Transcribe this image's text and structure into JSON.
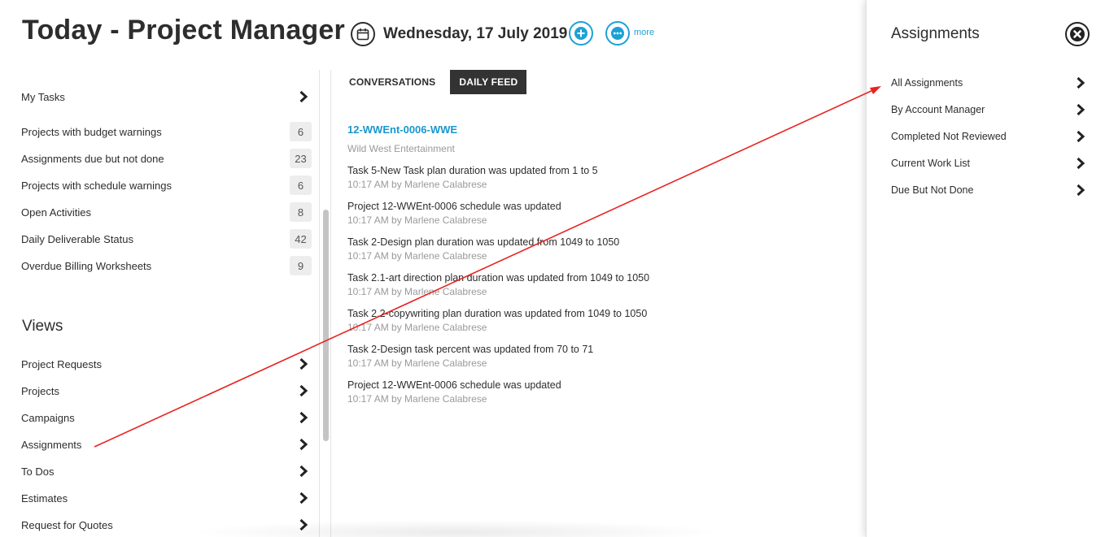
{
  "header": {
    "title": "Today - Project Manager",
    "date": "Wednesday, 17 July 2019",
    "more_label": "more"
  },
  "left": {
    "my_tasks_label": "My Tasks",
    "alerts": [
      {
        "label": "Projects with budget warnings",
        "count": "6"
      },
      {
        "label": "Assignments due but not done",
        "count": "23"
      },
      {
        "label": "Projects with schedule warnings",
        "count": "6"
      },
      {
        "label": "Open Activities",
        "count": "8"
      },
      {
        "label": "Daily Deliverable Status",
        "count": "42"
      },
      {
        "label": "Overdue Billing Worksheets",
        "count": "9"
      }
    ],
    "views_heading": "Views",
    "views": [
      {
        "label": "Project Requests"
      },
      {
        "label": "Projects"
      },
      {
        "label": "Campaigns"
      },
      {
        "label": "Assignments"
      },
      {
        "label": "To Dos"
      },
      {
        "label": "Estimates"
      },
      {
        "label": "Request for Quotes"
      }
    ]
  },
  "feed": {
    "tabs": [
      {
        "label": "CONVERSATIONS",
        "active": false
      },
      {
        "label": "DAILY FEED",
        "active": true
      }
    ],
    "project_link": "12-WWEnt-0006-WWE",
    "project_client": "Wild West Entertainment",
    "items": [
      {
        "text": "Task 5-New Task plan duration was updated from 1 to 5",
        "meta": "10:17 AM by Marlene Calabrese"
      },
      {
        "text": "Project 12-WWEnt-0006 schedule was updated",
        "meta": "10:17 AM by Marlene Calabrese"
      },
      {
        "text": "Task 2-Design plan duration was updated from 1049 to 1050",
        "meta": "10:17 AM by Marlene Calabrese"
      },
      {
        "text": "Task 2.1-art direction plan duration was updated from 1049 to 1050",
        "meta": "10:17 AM by Marlene Calabrese"
      },
      {
        "text": "Task 2.2-copywriting plan duration was updated from 1049 to 1050",
        "meta": "10:17 AM by Marlene Calabrese"
      },
      {
        "text": "Task 2-Design task percent was updated from 70 to 71",
        "meta": "10:17 AM by Marlene Calabrese"
      },
      {
        "text": "Project 12-WWEnt-0006 schedule was updated",
        "meta": "10:17 AM by Marlene Calabrese"
      }
    ]
  },
  "right_panel": {
    "title": "Assignments",
    "items": [
      {
        "label": "All Assignments"
      },
      {
        "label": "By Account Manager"
      },
      {
        "label": "Completed Not Reviewed"
      },
      {
        "label": "Current Work List"
      },
      {
        "label": "Due But Not Done"
      }
    ]
  },
  "colors": {
    "accent": "#1da1d5",
    "link": "#1a96cf",
    "annotation": "#e8231f",
    "active_tab_bg": "#333333"
  },
  "icons": {
    "calendar": "calendar-icon",
    "add": "plus-icon",
    "more": "ellipsis-icon",
    "close": "close-icon",
    "chevron": "chevron-right-icon"
  }
}
